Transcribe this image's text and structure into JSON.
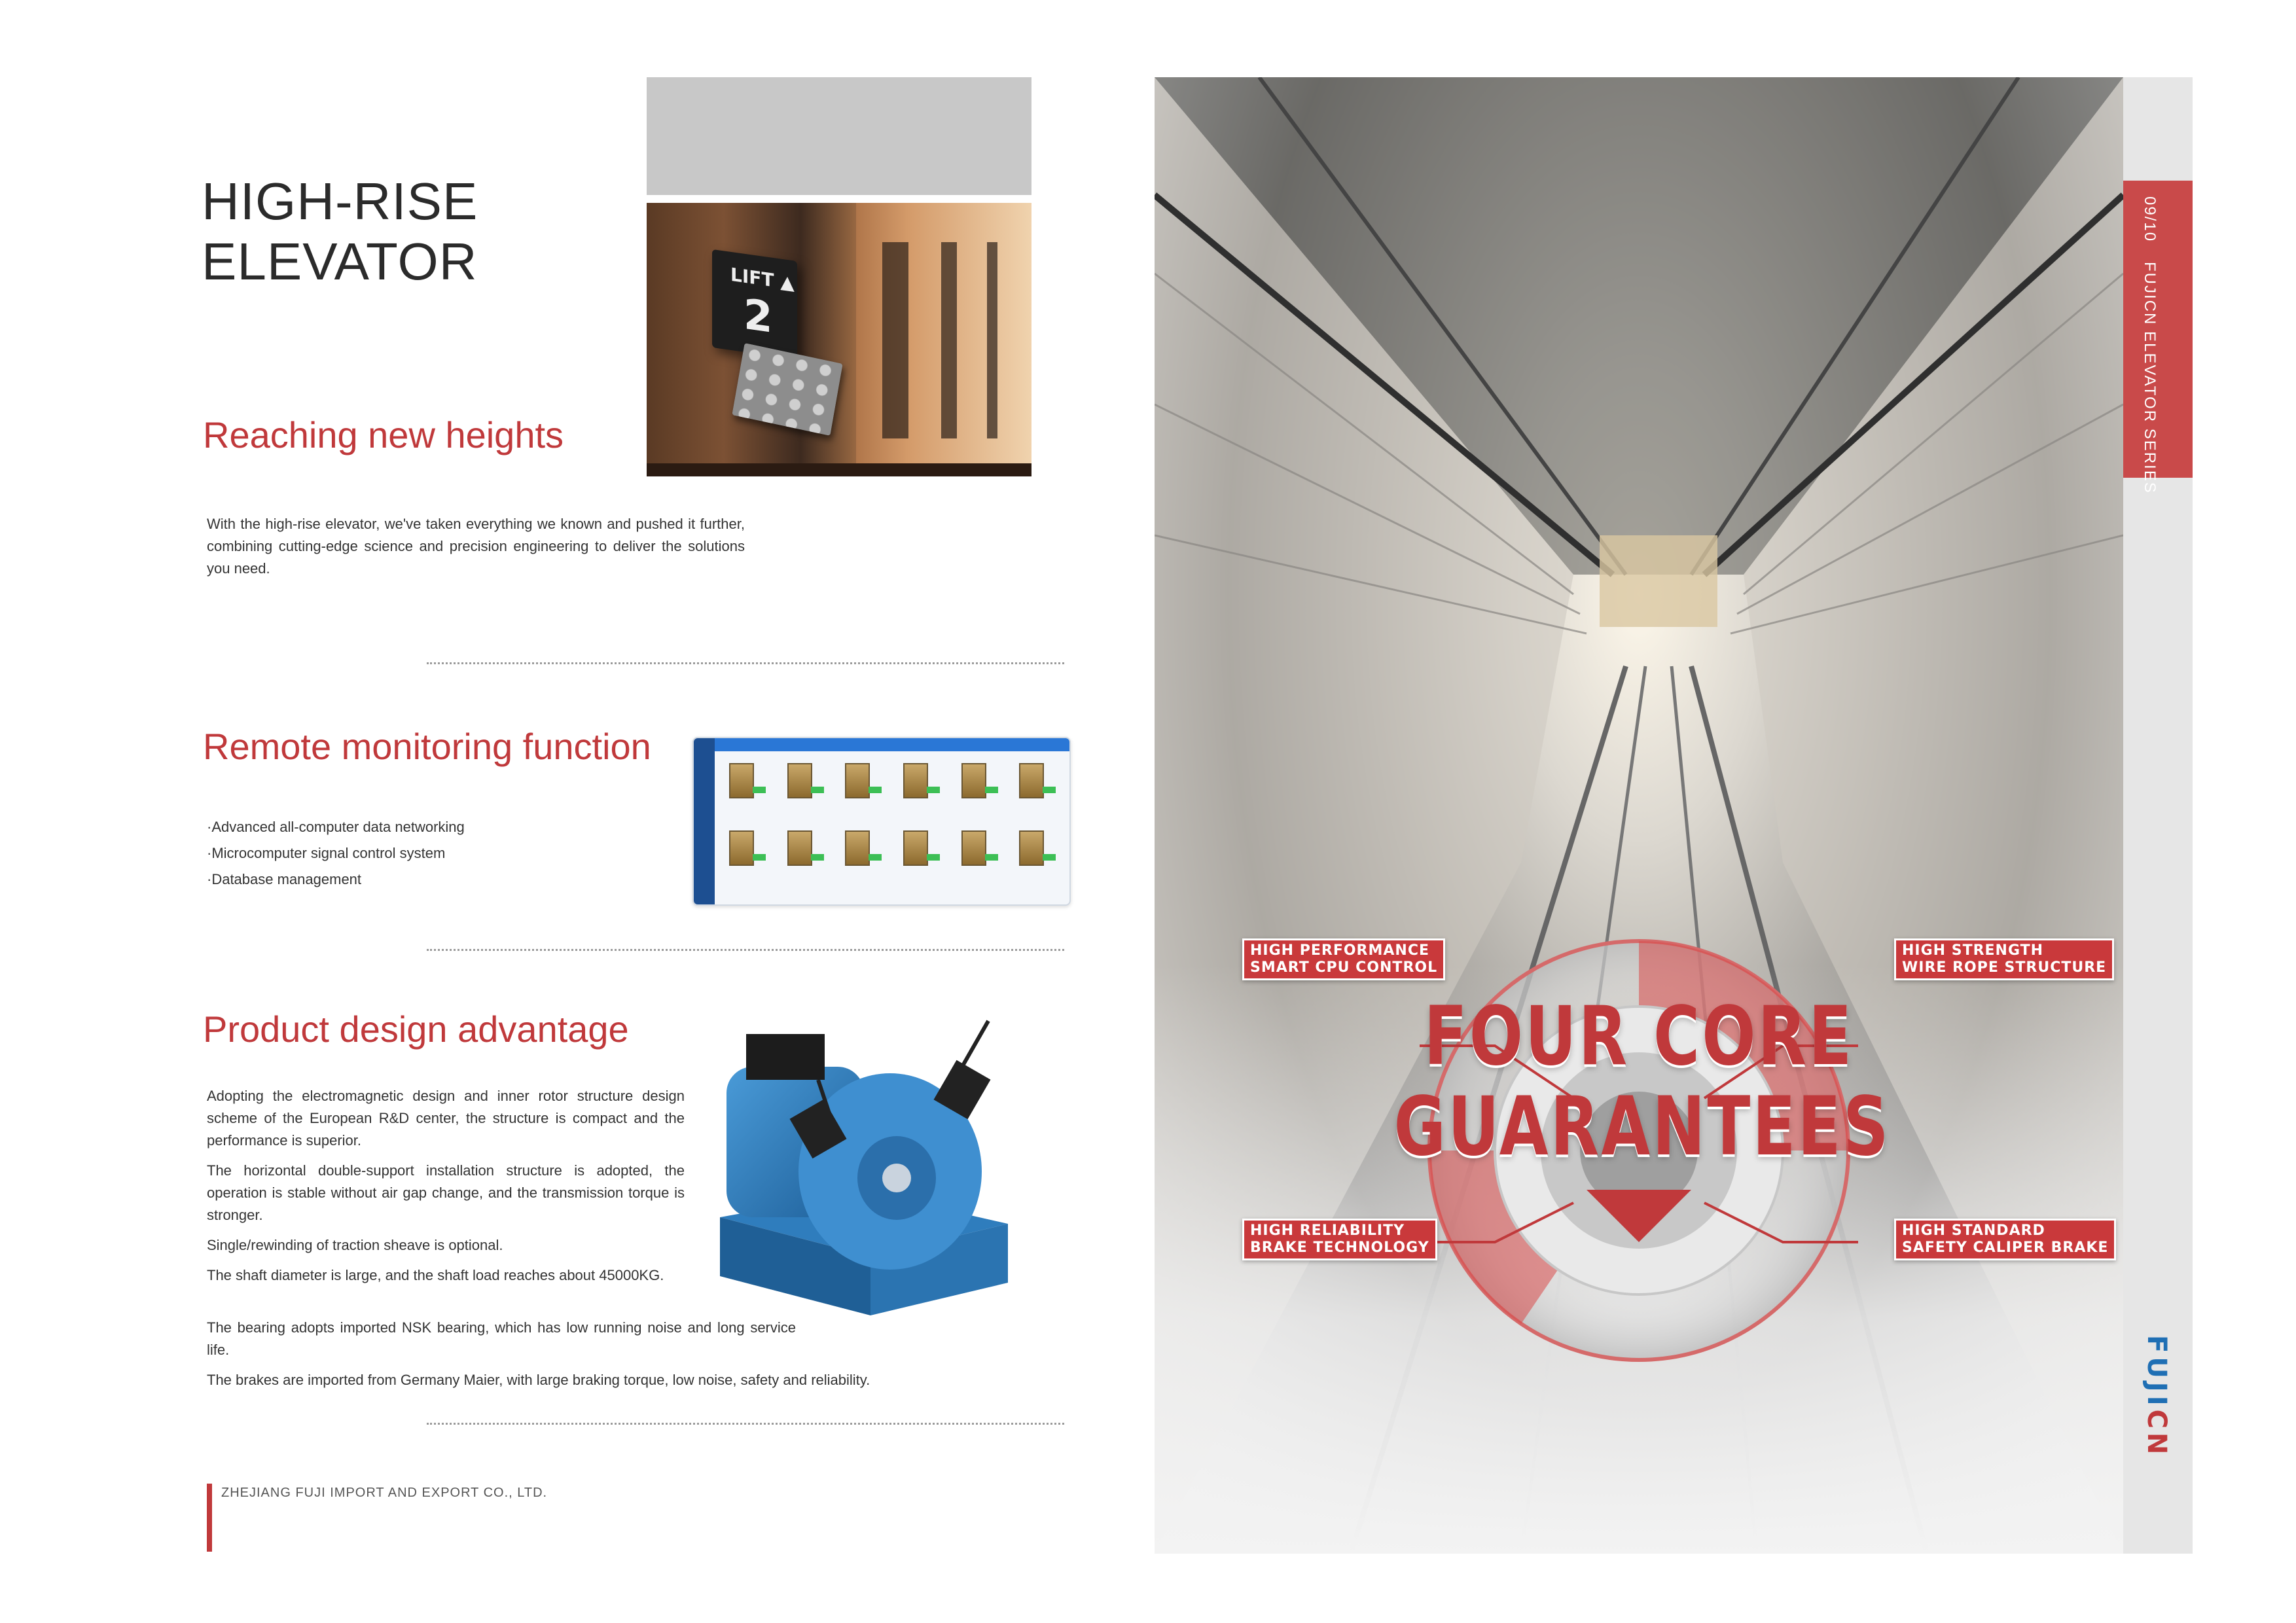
{
  "left_page": {
    "title_line1": "HIGH-RISE",
    "title_line2": "ELEVATOR",
    "lift_panel": {
      "label": "LIFT ▲",
      "floor": "2"
    },
    "section1": {
      "heading": "Reaching new heights",
      "text": "With the high-rise elevator, we've taken everything we known and pushed it further, combining cutting-edge science and precision engineering to deliver the solutions you need."
    },
    "section2": {
      "heading": "Remote monitoring function",
      "bullets": [
        "·Advanced all-computer data networking",
        "·Microcomputer signal control system",
        "·Database management"
      ]
    },
    "section3": {
      "heading": "Product design advantage",
      "paragraphs": [
        "Adopting the electromagnetic design and inner rotor structure design scheme of the European R&D center, the structure is compact and the performance is superior.",
        "The horizontal double-support installation structure is adopted, the operation is stable without air gap change, and the transmission torque is stronger.",
        "Single/rewinding of traction sheave is optional.",
        "The shaft diameter is large, and the shaft load reaches about 45000KG.",
        "The bearing adopts imported NSK bearing, which has low running noise and long service life.",
        "The brakes are imported from Germany Maier, with large braking torque, low noise, safety and reliability."
      ]
    },
    "company": "ZHEJIANG FUJI IMPORT AND EXPORT CO., LTD."
  },
  "right_page": {
    "page_number": "09/10",
    "series": "FUJICN ELEVATOR SERIES",
    "brand_main": "FUJI",
    "brand_accent": "CN",
    "headline_line1": "FOUR CORE",
    "headline_line2": "GUARANTEES",
    "labels": {
      "top_left": [
        "HIGH PERFORMANCE",
        "SMART CPU CONTROL"
      ],
      "top_right": [
        "HIGH STRENGTH",
        "WIRE ROPE STRUCTURE"
      ],
      "bottom_left": [
        "HIGH RELIABILITY",
        "BRAKE TECHNOLOGY"
      ],
      "bottom_right": [
        "HIGH STANDARD",
        "SAFETY CALIPER BRAKE"
      ]
    }
  },
  "colors": {
    "accent_red": "#c0393b",
    "brand_blue": "#1f6fb4",
    "grey_block": "#c8c8c8"
  }
}
